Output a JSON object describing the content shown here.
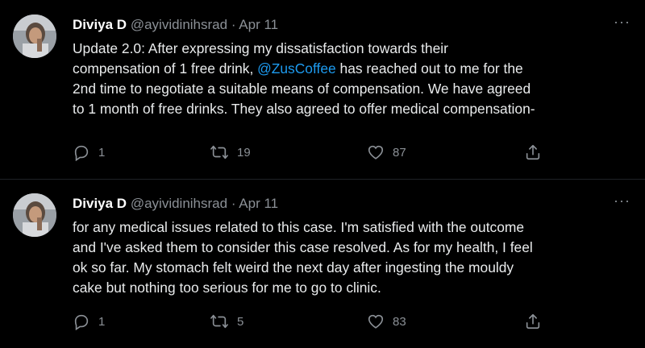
{
  "tweets": [
    {
      "display_name": "Diviya D",
      "handle": "@ayividinihsrad",
      "separator": "·",
      "date": "Apr 11",
      "lines": {
        "l1": "Update 2.0: After expressing my dissatisfaction towards their",
        "l2_pre": "compensation of 1 free drink, ",
        "l2_mention": "@ZusCoffee",
        "l2_post": " has reached out to me for the",
        "l3": "2nd time to negotiate a suitable means of compensation. We have agreed",
        "l4": "to 1 month of free drinks. They also agreed to offer medical compensation-"
      },
      "reply_count": "1",
      "retweet_count": "19",
      "like_count": "87"
    },
    {
      "display_name": "Diviya D",
      "handle": "@ayividinihsrad",
      "separator": "·",
      "date": "Apr 11",
      "lines": {
        "l1": "for any medical issues related to this case. I'm satisfied with the outcome",
        "l2": "and I've asked them to consider this case resolved. As for my health, I feel",
        "l3": "ok so far. My stomach felt weird the next day after ingesting the mouldy",
        "l4": "cake but nothing too serious for me to go to clinic."
      },
      "reply_count": "1",
      "retweet_count": "5",
      "like_count": "83"
    }
  ],
  "more_glyph": "···",
  "icons": {
    "reply": "reply-icon",
    "retweet": "retweet-icon",
    "like": "heart-icon",
    "share": "share-icon",
    "more": "more-options-icon"
  },
  "colors": {
    "background": "#000000",
    "text": "#e7e9ea",
    "secondary": "#8b9096",
    "link": "#1d9bf0"
  }
}
